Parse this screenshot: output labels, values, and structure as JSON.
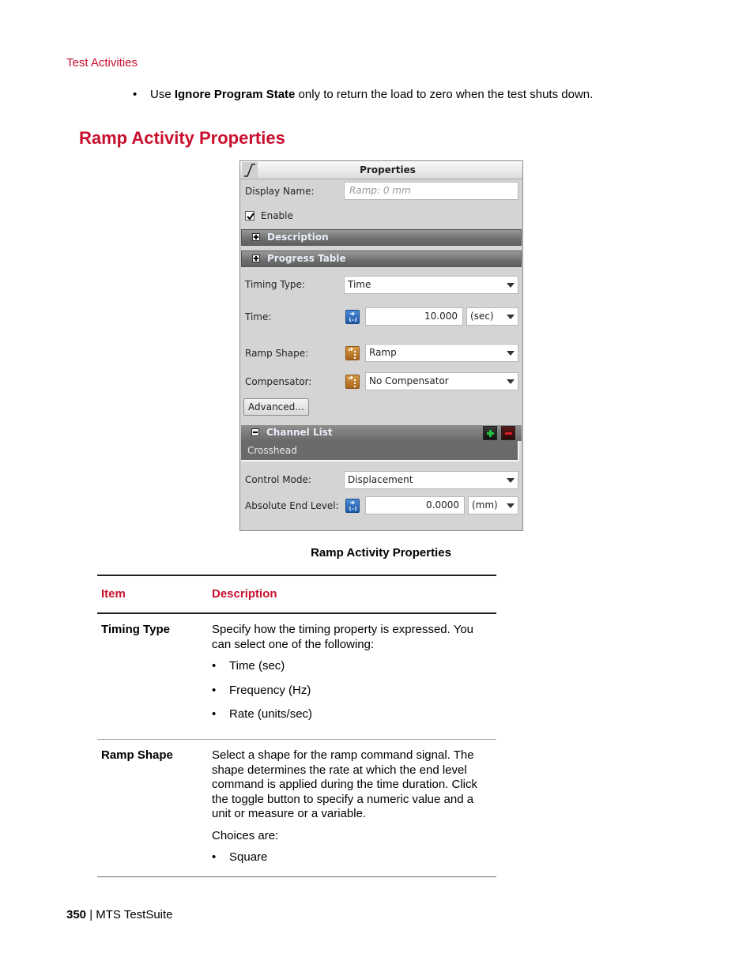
{
  "page": {
    "running_head": "Test Activities",
    "intro_bullet": {
      "prefix": "Use ",
      "bold": "Ignore Program State",
      "suffix": " only to return the load to zero when the test shuts down."
    },
    "section_title": "Ramp Activity Properties",
    "figure_caption": "Ramp Activity Properties",
    "footer": {
      "page_number": "350",
      "separator": " | ",
      "doc_title": "MTS TestSuite"
    }
  },
  "panel": {
    "title": "Properties",
    "header_icon": "ramp-icon",
    "display_name": {
      "label": "Display Name:",
      "placeholder": "Ramp: 0 mm"
    },
    "enable": {
      "label": "Enable",
      "checked": true
    },
    "groups": [
      {
        "label": "Description",
        "expanded": false
      },
      {
        "label": "Progress Table",
        "expanded": false
      }
    ],
    "timing_type": {
      "label": "Timing Type:",
      "value": "Time"
    },
    "time": {
      "label": "Time:",
      "value": "10.000",
      "unit": "(sec)",
      "toggle_icon": "numeric-toggle-icon"
    },
    "ramp_shape": {
      "label": "Ramp Shape:",
      "value": "Ramp",
      "toggle_icon": "variable-toggle-icon"
    },
    "compensator": {
      "label": "Compensator:",
      "value": "No Compensator",
      "toggle_icon": "variable-toggle-icon"
    },
    "advanced_button": "Advanced...",
    "channel_list": {
      "label": "Channel List",
      "expanded": true,
      "add_icon": "plus-icon",
      "remove_icon": "minus-icon",
      "items": [
        "Crosshead"
      ]
    },
    "control_mode": {
      "label": "Control Mode:",
      "value": "Displacement"
    },
    "absolute_end_level": {
      "label": "Absolute End Level:",
      "value": "0.0000",
      "unit": "(mm)",
      "toggle_icon": "numeric-toggle-icon"
    }
  },
  "table": {
    "headers": {
      "item": "Item",
      "description": "Description"
    },
    "rows": [
      {
        "item": "Timing Type",
        "paragraphs": [
          "Specify how the timing property is expressed. You can select one of the following:"
        ],
        "bullets": [
          "Time (sec)",
          "Frequency (Hz)",
          "Rate (units/sec)"
        ]
      },
      {
        "item": "Ramp Shape",
        "paragraphs": [
          "Select a shape for the ramp command signal. The shape determines the rate at which the end level command is applied during the time duration. Click the toggle button to specify a numeric value and a unit or measure or a variable.",
          "Choices are:"
        ],
        "bullets": [
          "Square"
        ]
      }
    ]
  },
  "colors": {
    "accent_red": "#c8102e",
    "panel_bg": "#d4d4d4",
    "group_bar": "#6e6e6e",
    "add_green": "#22c33a",
    "remove_red": "#d81f26"
  }
}
